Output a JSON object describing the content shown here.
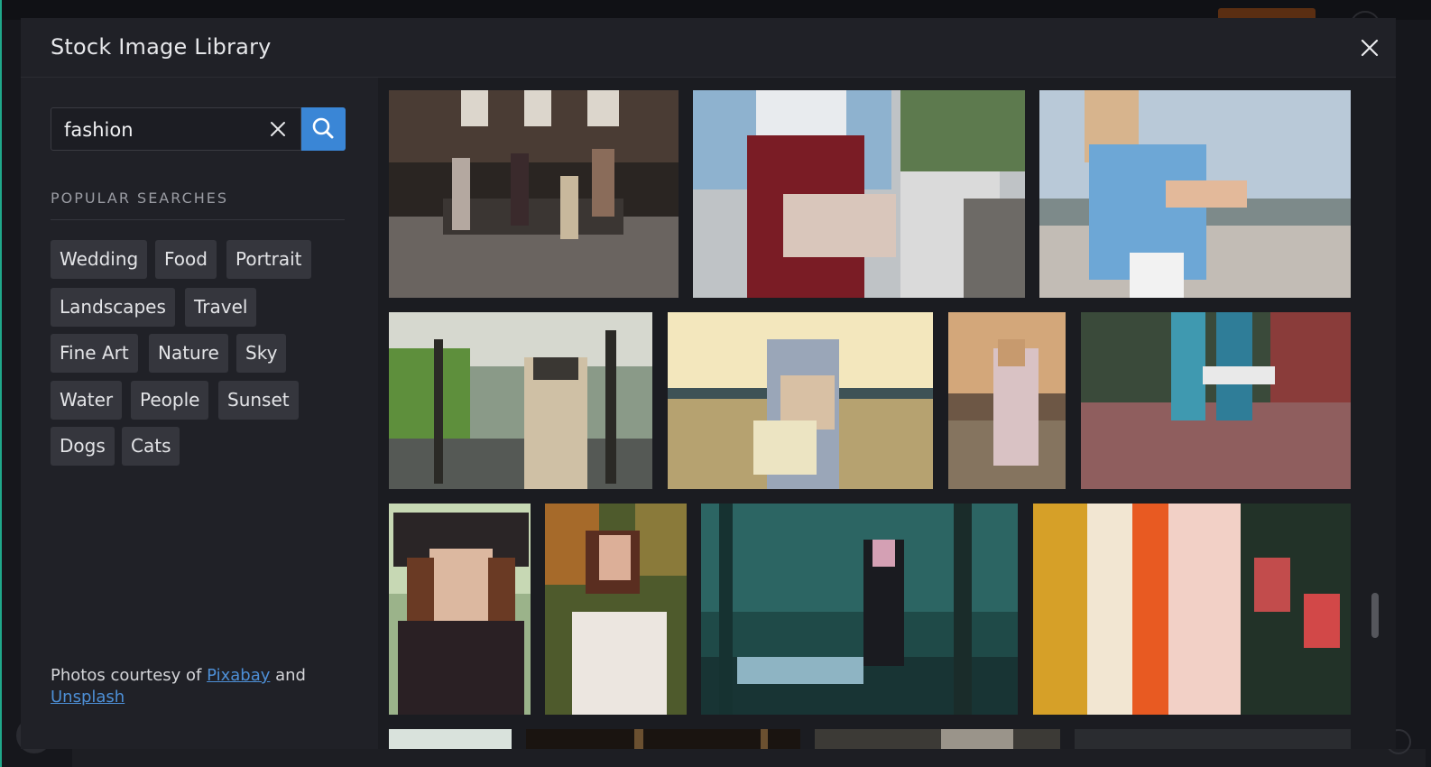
{
  "modal": {
    "title": "Stock Image Library",
    "close_icon": "close-icon"
  },
  "search": {
    "value": "fashion",
    "clear_icon": "clear-icon",
    "submit_icon": "search-icon"
  },
  "popular": {
    "heading": "POPULAR SEARCHES",
    "tags": [
      "Wedding",
      "Food",
      "Portrait",
      "Landscapes",
      "Travel",
      "Fine Art",
      "Nature",
      "Sky",
      "Water",
      "People",
      "Sunset",
      "Dogs",
      "Cats"
    ]
  },
  "credit": {
    "prefix": "Photos courtesy of ",
    "link1": "Pixabay",
    "middle": " and",
    "link2": "Unsplash"
  },
  "colors": {
    "accent": "#3a86d6",
    "tag_bg": "#35363d",
    "modal_bg": "#1e1f25"
  },
  "gallery": {
    "images": [
      "group-on-bench-photo",
      "red-skirt-clutch-photo",
      "blue-knit-scarf-photo",
      "woman-in-hat-on-stairs-photo",
      "woman-sunglasses-flowers-photo",
      "woman-sitting-on-deck-photo",
      "two-women-patterned-outfits-photo",
      "woman-black-hat-photo",
      "woman-floral-dress-photo",
      "woman-in-dark-forest-photo",
      "colorful-pillows-photo",
      "partial-row-photo-1",
      "partial-row-photo-2",
      "partial-row-photo-3",
      "partial-row-photo-4"
    ]
  }
}
